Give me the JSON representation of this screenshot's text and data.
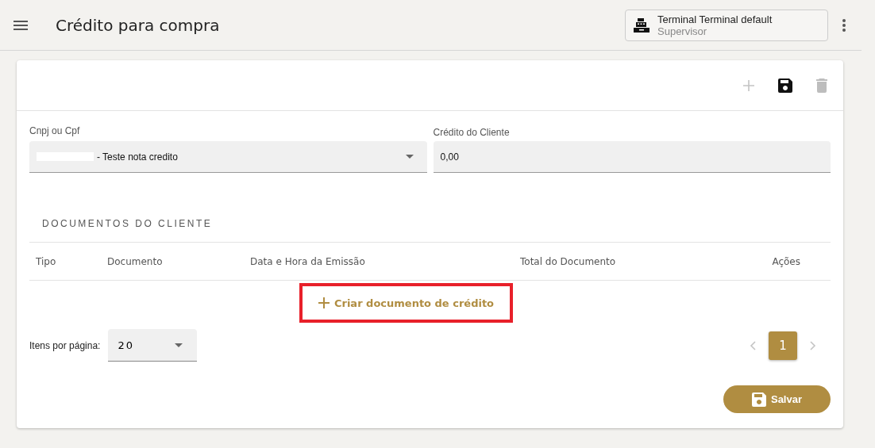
{
  "app_bar": {
    "title": "Crédito para compra",
    "terminal": {
      "name": "Terminal Terminal default",
      "role": "Supervisor"
    }
  },
  "toolbar": [
    {
      "kind": "add",
      "disabled": true
    },
    {
      "kind": "save",
      "disabled": false
    },
    {
      "kind": "delete",
      "disabled": true
    }
  ],
  "form": {
    "customer": {
      "label": "Cnpj ou Cpf",
      "value": "- Teste nota credito",
      "redacted": true
    },
    "credit": {
      "label": "Crédito do Cliente",
      "value": "0,00"
    }
  },
  "documents": {
    "title": "DOCUMENTOS DO CLIENTE",
    "columns": [
      "Tipo",
      "Documento",
      "Data e Hora da Emissão",
      "Total do Documento",
      "Ações"
    ],
    "create_button": {
      "label": "Criar documento de crédito",
      "highlighted": true
    }
  },
  "pagination": {
    "items_label": "Itens por página:",
    "page_size": "20",
    "prev_disabled": true,
    "next_disabled": true,
    "pages": [
      {
        "label": "1",
        "selected": true
      }
    ]
  },
  "save_button": "Salvar"
}
